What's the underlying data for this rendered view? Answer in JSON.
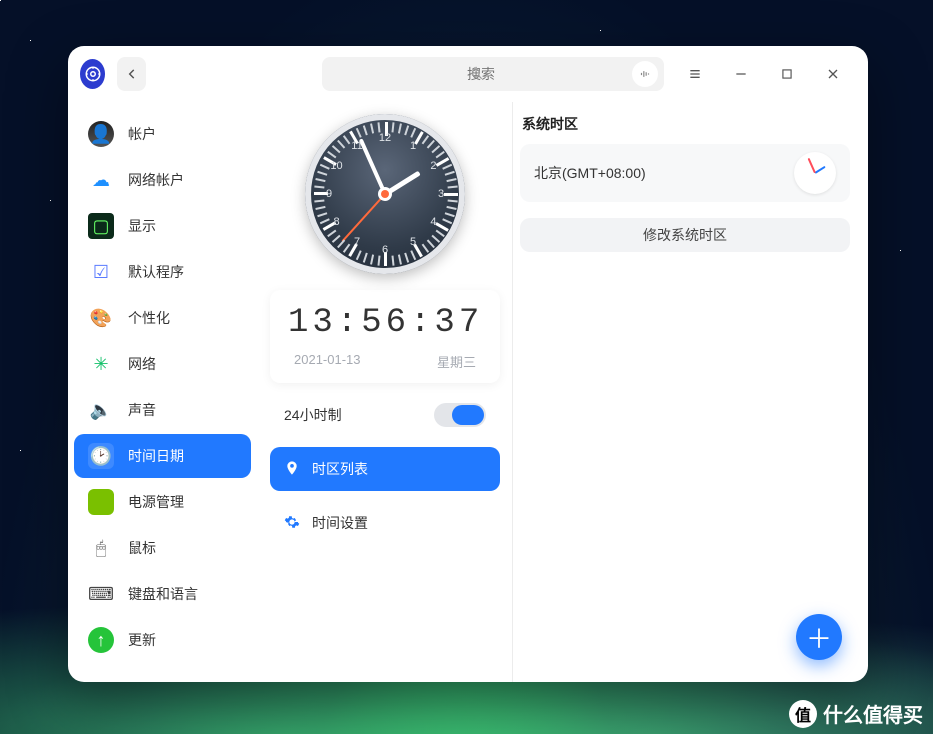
{
  "search": {
    "placeholder": "搜索"
  },
  "sidebar": {
    "items": [
      {
        "label": "帐户"
      },
      {
        "label": "网络帐户"
      },
      {
        "label": "显示"
      },
      {
        "label": "默认程序"
      },
      {
        "label": "个性化"
      },
      {
        "label": "网络"
      },
      {
        "label": "声音"
      },
      {
        "label": "时间日期"
      },
      {
        "label": "电源管理"
      },
      {
        "label": "鼠标"
      },
      {
        "label": "键盘和语言"
      },
      {
        "label": "更新"
      }
    ]
  },
  "clock": {
    "digital": "13:56:37",
    "date": "2021-01-13",
    "weekday": "星期三",
    "hour_angle": 58,
    "minute_angle": 336,
    "second_angle": 222
  },
  "settings": {
    "h24_label": "24小时制",
    "tz_list_label": "时区列表",
    "time_settings_label": "时间设置"
  },
  "right": {
    "heading": "系统时区",
    "current_tz": "北京(GMT+08:00)",
    "change_btn": "修改系统时区"
  },
  "watermark": "什么值得买"
}
